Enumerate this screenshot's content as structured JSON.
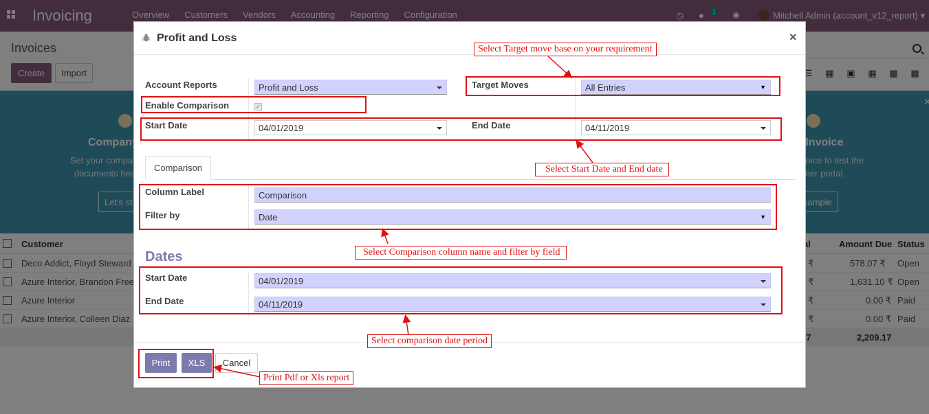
{
  "navbar": {
    "brand": "Invoicing",
    "menu": [
      "Overview",
      "Customers",
      "Vendors",
      "Accounting",
      "Reporting",
      "Configuration"
    ],
    "messages_badge": "1",
    "user": "Mitchell Admin (account_v12_report)"
  },
  "control_panel": {
    "title": "Invoices",
    "create_label": "Create",
    "import_label": "Import"
  },
  "banner": {
    "left_title": "Company",
    "left_line1": "Set your compa",
    "left_line2": "documents hea",
    "left_button": "Let's st",
    "right_title": "e Invoice",
    "right_line1": "voice to test the",
    "right_line2": "mer portal.",
    "right_button": "d sample"
  },
  "list": {
    "headers": {
      "customer": "Customer",
      "total": "al",
      "amount_due": "Amount Due",
      "status": "Status"
    },
    "rows": [
      {
        "customer": "Deco Addict, Floyd Steward",
        "total": "₹",
        "amount_due": "578.07 ₹",
        "status": "Open"
      },
      {
        "customer": "Azure Interior, Brandon Free",
        "total": "₹",
        "amount_due": "1,631.10 ₹",
        "status": "Open"
      },
      {
        "customer": "Azure Interior",
        "total": "₹",
        "amount_due": "0.00 ₹",
        "status": "Paid"
      },
      {
        "customer": "Azure Interior, Colleen Diaz",
        "total": "₹",
        "amount_due": "0.00 ₹",
        "status": "Paid"
      }
    ],
    "footer": {
      "total": "17",
      "amount_due": "2,209.17"
    }
  },
  "modal": {
    "title": "Profit and Loss",
    "close_symbol": "×",
    "account_reports_label": "Account Reports",
    "account_reports_value": "Profit and Loss",
    "target_moves_label": "Target Moves",
    "target_moves_value": "All Entries",
    "enable_comparison_label": "Enable Comparison",
    "enable_comparison_checked": true,
    "start_date_label": "Start Date",
    "start_date_value": "04/01/2019",
    "end_date_label": "End Date",
    "end_date_value": "04/11/2019",
    "tab_label": "Comparison",
    "column_label_label": "Column Label",
    "column_label_value": "Comparison",
    "filter_by_label": "Filter by",
    "filter_by_value": "Date",
    "dates_title": "Dates",
    "cmp_start_date_label": "Start Date",
    "cmp_start_date_value": "04/01/2019",
    "cmp_end_date_label": "End Date",
    "cmp_end_date_value": "04/11/2019",
    "print_label": "Print",
    "xls_label": "XLS",
    "cancel_label": "Cancel"
  },
  "annotations": {
    "target_move": "Select Target move base on your requirement",
    "dates": "Select Start Date and End date",
    "comparison": "Select Comparison column name and filter by field",
    "comparison_dates": "Select comparison date period",
    "print": "Print Pdf or Xls report"
  },
  "colors": {
    "navbar": "#875a7b",
    "primary_button": "#7c7bad",
    "required_field": "#d2d2ff",
    "annotation": "#e01010",
    "banner": "#3f95ae"
  }
}
